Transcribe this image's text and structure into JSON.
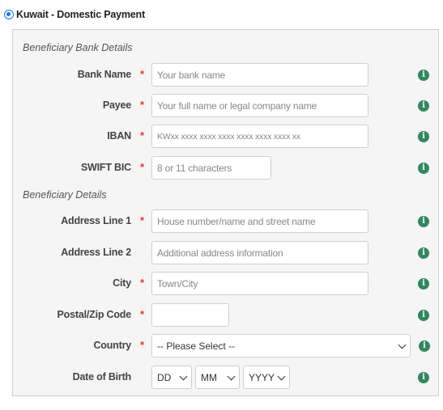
{
  "payment_option": {
    "label": "Kuwait - Domestic Payment",
    "selected": true
  },
  "sections": {
    "bank_details": "Beneficiary Bank Details",
    "beneficiary_details": "Beneficiary Details"
  },
  "fields": {
    "bank_name": {
      "label": "Bank Name",
      "required": "*",
      "placeholder": "Your bank name"
    },
    "payee": {
      "label": "Payee",
      "required": "*",
      "placeholder": "Your full name or legal company name"
    },
    "iban": {
      "label": "IBAN",
      "required": "*",
      "placeholder": "KWxx xxxx xxxx xxxx xxxx xxxx xxxx xx"
    },
    "swift": {
      "label": "SWIFT BIC",
      "required": "*",
      "placeholder": "8 or 11 characters"
    },
    "address1": {
      "label": "Address Line 1",
      "required": "*",
      "placeholder": "House number/name and street name"
    },
    "address2": {
      "label": "Address Line 2",
      "placeholder": "Additional address information"
    },
    "city": {
      "label": "City",
      "required": "*",
      "placeholder": "Town/City"
    },
    "postal": {
      "label": "Postal/Zip Code",
      "required": "*",
      "placeholder": ""
    },
    "country": {
      "label": "Country",
      "required": "*",
      "value": "-- Please Select --"
    },
    "dob": {
      "label": "Date of Birth",
      "day": "DD",
      "month": "MM",
      "year": "YYYY"
    }
  },
  "icons": {
    "info": "info-icon",
    "chevron": "chevron-down-icon"
  },
  "colors": {
    "info": "#2e8a5e",
    "required": "#e53935",
    "radio": "#1a73e8"
  }
}
